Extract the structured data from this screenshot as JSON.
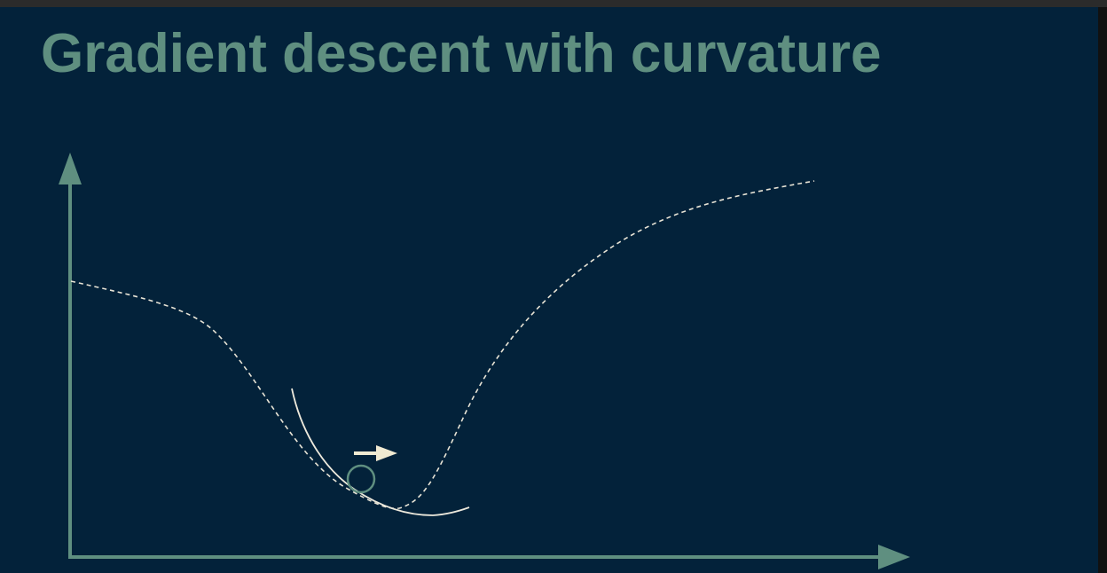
{
  "slide": {
    "title": "Gradient descent with curvature"
  },
  "colors": {
    "background": "#03223a",
    "accent": "#5f8f80",
    "curve": "#e8e4d6",
    "arrow": "#f0ead2"
  },
  "icons": {
    "step_arrow": "right-arrow-icon",
    "position_marker": "circle-icon"
  }
}
